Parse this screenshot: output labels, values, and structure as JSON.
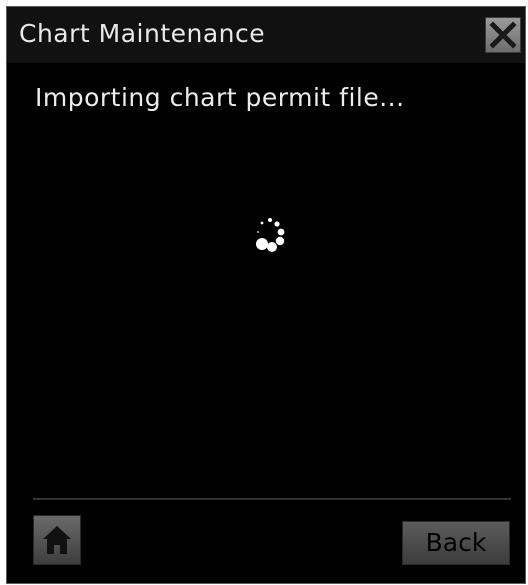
{
  "window": {
    "title": "Chart Maintenance"
  },
  "content": {
    "message": "Importing chart permit file..."
  },
  "status": {
    "busy_indicator": "loading-spinner-icon"
  },
  "footer": {
    "home_icon": "home-icon",
    "back_label": "Back"
  },
  "colors": {
    "background": "#000000",
    "title_text": "#e8e8e8",
    "button_face": "#4a4a4a"
  }
}
